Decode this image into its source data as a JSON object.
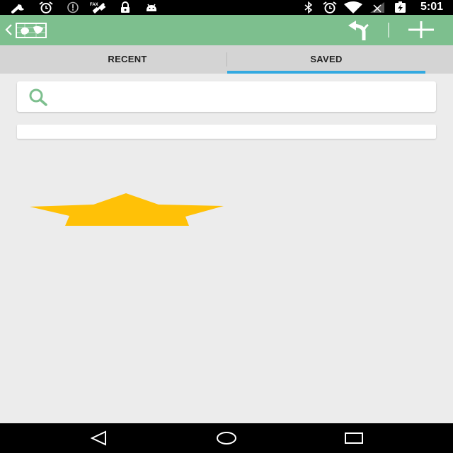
{
  "status_bar": {
    "time": "5:01",
    "left_icons": [
      "wrench-icon",
      "alarm-icon",
      "info-icon",
      "satellite-fax-icon",
      "lock-icon",
      "android-icon"
    ],
    "right_icons": [
      "bluetooth-icon",
      "alarm-icon",
      "wifi-icon",
      "signal-icon",
      "battery-charging-icon"
    ]
  },
  "action_bar": {
    "color": "#7dbf8e",
    "up_icon": "chevron-left-icon",
    "app_icon": "map-icon",
    "actions": [
      "route-icon",
      "add-icon"
    ]
  },
  "tabs": [
    {
      "label": "RECENT",
      "selected": false
    },
    {
      "label": "SAVED",
      "selected": true
    }
  ],
  "tab_indicator_color": "#33a9e0",
  "search": {
    "icon": "search-icon",
    "placeholder": "",
    "value": ""
  },
  "empty_state": {
    "icon": "star-icon",
    "color": "#ffc107"
  },
  "nav_bar": {
    "buttons": [
      "back-icon",
      "home-icon",
      "recents-icon"
    ]
  }
}
